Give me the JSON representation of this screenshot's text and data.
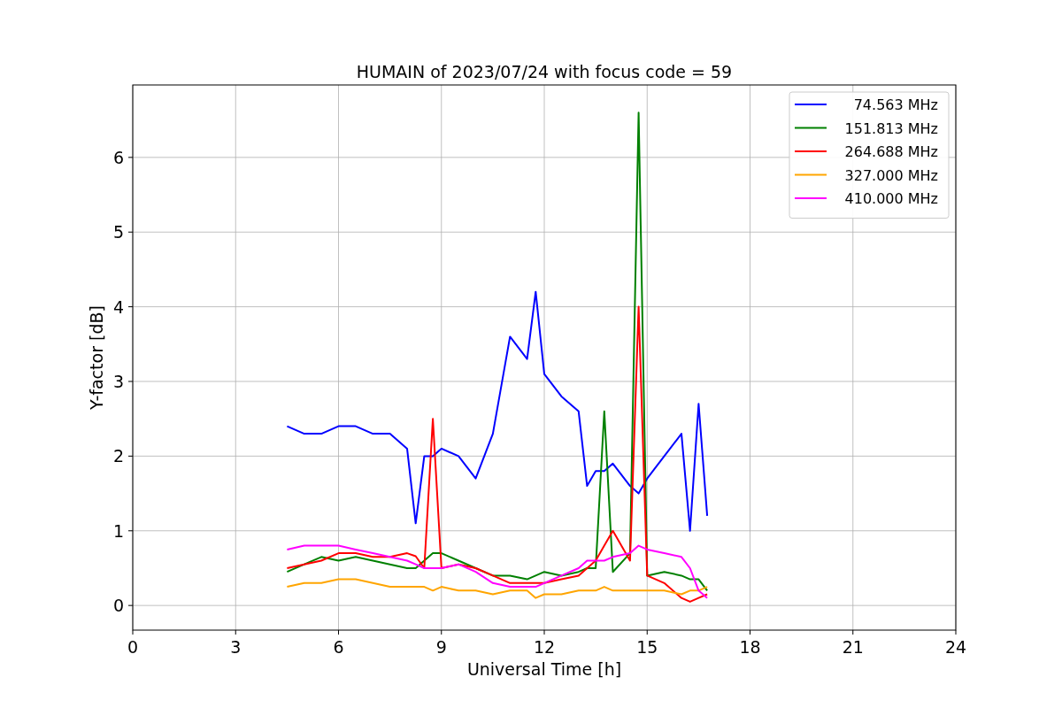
{
  "chart": {
    "chart_data": {
      "type": "line",
      "title": "HUMAIN of 2023/07/24 with focus code = 59",
      "xlabel": "Universal Time [h]",
      "ylabel": "Y-factor [dB]",
      "x": [
        4.5,
        5,
        5.5,
        6,
        6.5,
        7,
        7.5,
        8,
        8.25,
        8.5,
        8.75,
        9,
        9.5,
        10,
        10.5,
        11,
        11.5,
        11.75,
        12,
        12.5,
        13,
        13.25,
        13.5,
        13.75,
        14,
        14.5,
        14.75,
        15,
        15.5,
        16,
        16.25,
        16.5,
        16.75
      ],
      "series": [
        {
          "name": "74.563 MHz",
          "color": "#0000ff",
          "values": [
            2.4,
            2.3,
            2.3,
            2.4,
            2.4,
            2.3,
            2.3,
            2.1,
            1.1,
            2.0,
            2.0,
            2.1,
            2.0,
            1.7,
            2.3,
            3.6,
            3.3,
            4.2,
            3.1,
            2.8,
            2.6,
            1.6,
            1.8,
            1.8,
            1.9,
            1.6,
            1.5,
            1.7,
            2.0,
            2.3,
            1.0,
            2.7,
            1.2
          ]
        },
        {
          "name": "151.813 MHz",
          "color": "#008000",
          "values": [
            0.45,
            0.55,
            0.65,
            0.6,
            0.65,
            0.6,
            0.55,
            0.5,
            0.5,
            0.6,
            0.7,
            0.7,
            0.6,
            0.5,
            0.4,
            0.4,
            0.35,
            0.4,
            0.45,
            0.4,
            0.45,
            0.5,
            0.5,
            2.6,
            0.45,
            0.7,
            6.6,
            0.4,
            0.45,
            0.4,
            0.35,
            0.35,
            0.2
          ]
        },
        {
          "name": "264.688 MHz",
          "color": "#ff0000",
          "values": [
            0.5,
            0.55,
            0.6,
            0.7,
            0.7,
            0.65,
            0.65,
            0.7,
            0.66,
            0.5,
            2.5,
            0.5,
            0.55,
            0.5,
            0.4,
            0.3,
            0.3,
            0.3,
            0.3,
            0.35,
            0.4,
            0.5,
            0.6,
            0.8,
            1.0,
            0.6,
            4.0,
            0.4,
            0.3,
            0.1,
            0.05,
            0.1,
            0.15
          ]
        },
        {
          "name": "327.000 MHz",
          "color": "#ffa500",
          "values": [
            0.25,
            0.3,
            0.3,
            0.35,
            0.35,
            0.3,
            0.25,
            0.25,
            0.25,
            0.25,
            0.2,
            0.25,
            0.2,
            0.2,
            0.15,
            0.2,
            0.2,
            0.1,
            0.15,
            0.15,
            0.2,
            0.2,
            0.2,
            0.25,
            0.2,
            0.2,
            0.2,
            0.2,
            0.2,
            0.15,
            0.2,
            0.2,
            0.25
          ]
        },
        {
          "name": "410.000 MHz",
          "color": "#ff00ff",
          "values": [
            0.75,
            0.8,
            0.8,
            0.8,
            0.75,
            0.7,
            0.65,
            0.6,
            0.55,
            0.5,
            0.5,
            0.5,
            0.55,
            0.45,
            0.3,
            0.25,
            0.25,
            0.25,
            0.3,
            0.4,
            0.5,
            0.6,
            0.6,
            0.6,
            0.65,
            0.7,
            0.8,
            0.75,
            0.7,
            0.65,
            0.5,
            0.2,
            0.1
          ]
        }
      ],
      "xlim": [
        0,
        24
      ],
      "ylim": [
        -0.33,
        6.97
      ],
      "xticks": [
        0,
        3,
        6,
        9,
        12,
        15,
        18,
        21,
        24
      ],
      "yticks": [
        0,
        1,
        2,
        3,
        4,
        5,
        6
      ],
      "grid": true,
      "legend": true
    }
  }
}
